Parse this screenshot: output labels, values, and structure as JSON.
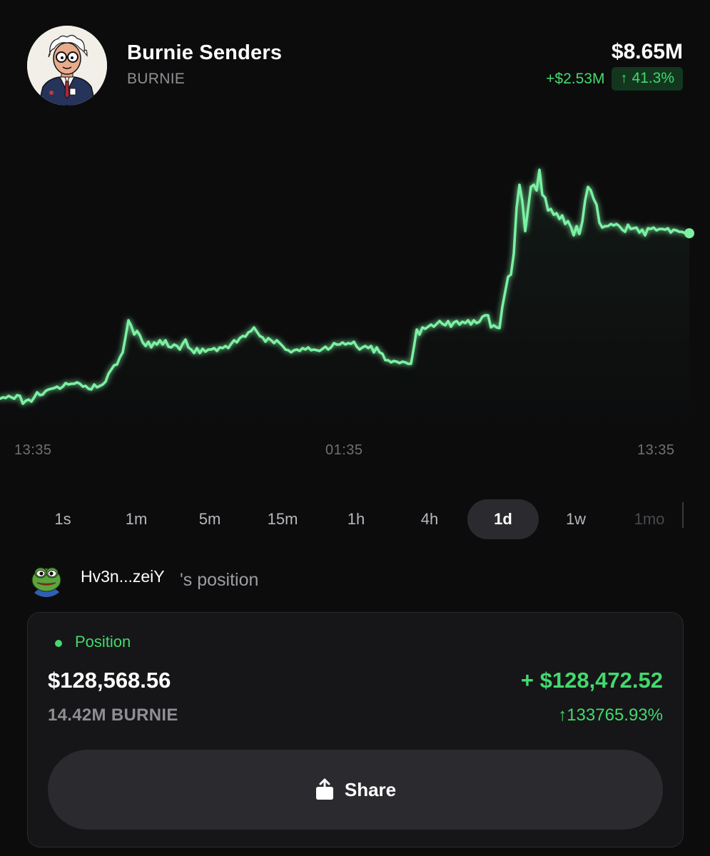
{
  "token": {
    "name": "Burnie Senders",
    "symbol": "BURNIE",
    "price": "$8.65M",
    "change_abs": "+$2.53M",
    "change_pct": "41.3%"
  },
  "chart_data": {
    "type": "line",
    "x_tick_labels": [
      "13:35",
      "01:35",
      "13:35"
    ],
    "line_color": "#7cf1a3",
    "y_unit": "$M market cap",
    "points": [
      [
        0,
        5.91
      ],
      [
        4,
        5.93
      ],
      [
        8,
        5.92
      ],
      [
        12,
        5.95
      ],
      [
        16,
        5.93
      ],
      [
        20,
        5.91
      ],
      [
        24,
        5.96
      ],
      [
        28,
        5.95
      ],
      [
        32,
        5.84
      ],
      [
        36,
        5.88
      ],
      [
        40,
        5.9
      ],
      [
        44,
        5.87
      ],
      [
        48,
        5.93
      ],
      [
        52,
        6.0
      ],
      [
        56,
        5.96
      ],
      [
        60,
        5.97
      ],
      [
        64,
        6.02
      ],
      [
        68,
        6.04
      ],
      [
        72,
        6.05
      ],
      [
        76,
        6.06
      ],
      [
        80,
        6.08
      ],
      [
        84,
        6.05
      ],
      [
        88,
        6.08
      ],
      [
        92,
        6.13
      ],
      [
        96,
        6.11
      ],
      [
        100,
        6.12
      ],
      [
        104,
        6.12
      ],
      [
        108,
        6.14
      ],
      [
        112,
        6.12
      ],
      [
        116,
        6.08
      ],
      [
        120,
        6.09
      ],
      [
        124,
        6.05
      ],
      [
        128,
        6.04
      ],
      [
        132,
        6.11
      ],
      [
        136,
        6.07
      ],
      [
        140,
        6.09
      ],
      [
        144,
        6.11
      ],
      [
        148,
        6.15
      ],
      [
        152,
        6.26
      ],
      [
        156,
        6.32
      ],
      [
        160,
        6.38
      ],
      [
        164,
        6.39
      ],
      [
        168,
        6.49
      ],
      [
        172,
        6.56
      ],
      [
        176,
        6.78
      ],
      [
        180,
        7.01
      ],
      [
        184,
        6.93
      ],
      [
        188,
        6.81
      ],
      [
        192,
        6.86
      ],
      [
        196,
        6.8
      ],
      [
        200,
        6.7
      ],
      [
        204,
        6.65
      ],
      [
        208,
        6.71
      ],
      [
        212,
        6.63
      ],
      [
        216,
        6.7
      ],
      [
        220,
        6.67
      ],
      [
        224,
        6.73
      ],
      [
        228,
        6.67
      ],
      [
        232,
        6.73
      ],
      [
        236,
        6.64
      ],
      [
        240,
        6.63
      ],
      [
        244,
        6.67
      ],
      [
        248,
        6.65
      ],
      [
        252,
        6.6
      ],
      [
        256,
        6.68
      ],
      [
        260,
        6.74
      ],
      [
        264,
        6.63
      ],
      [
        268,
        6.6
      ],
      [
        272,
        6.55
      ],
      [
        276,
        6.62
      ],
      [
        280,
        6.55
      ],
      [
        284,
        6.61
      ],
      [
        288,
        6.57
      ],
      [
        292,
        6.6
      ],
      [
        296,
        6.6
      ],
      [
        300,
        6.62
      ],
      [
        304,
        6.58
      ],
      [
        308,
        6.63
      ],
      [
        312,
        6.62
      ],
      [
        316,
        6.65
      ],
      [
        320,
        6.62
      ],
      [
        324,
        6.68
      ],
      [
        328,
        6.73
      ],
      [
        332,
        6.7
      ],
      [
        336,
        6.76
      ],
      [
        340,
        6.79
      ],
      [
        344,
        6.78
      ],
      [
        348,
        6.84
      ],
      [
        352,
        6.86
      ],
      [
        356,
        6.91
      ],
      [
        360,
        6.85
      ],
      [
        364,
        6.79
      ],
      [
        368,
        6.77
      ],
      [
        372,
        6.71
      ],
      [
        376,
        6.76
      ],
      [
        380,
        6.73
      ],
      [
        384,
        6.69
      ],
      [
        388,
        6.73
      ],
      [
        392,
        6.69
      ],
      [
        396,
        6.65
      ],
      [
        400,
        6.6
      ],
      [
        404,
        6.59
      ],
      [
        408,
        6.56
      ],
      [
        412,
        6.59
      ],
      [
        416,
        6.6
      ],
      [
        420,
        6.58
      ],
      [
        424,
        6.62
      ],
      [
        428,
        6.6
      ],
      [
        432,
        6.63
      ],
      [
        436,
        6.59
      ],
      [
        440,
        6.6
      ],
      [
        444,
        6.59
      ],
      [
        448,
        6.58
      ],
      [
        452,
        6.61
      ],
      [
        456,
        6.64
      ],
      [
        460,
        6.6
      ],
      [
        464,
        6.63
      ],
      [
        468,
        6.69
      ],
      [
        472,
        6.67
      ],
      [
        476,
        6.67
      ],
      [
        480,
        6.7
      ],
      [
        484,
        6.67
      ],
      [
        488,
        6.69
      ],
      [
        492,
        6.68
      ],
      [
        496,
        6.71
      ],
      [
        500,
        6.64
      ],
      [
        504,
        6.6
      ],
      [
        508,
        6.63
      ],
      [
        512,
        6.65
      ],
      [
        516,
        6.62
      ],
      [
        520,
        6.65
      ],
      [
        524,
        6.56
      ],
      [
        528,
        6.63
      ],
      [
        532,
        6.56
      ],
      [
        536,
        6.54
      ],
      [
        540,
        6.45
      ],
      [
        544,
        6.45
      ],
      [
        548,
        6.42
      ],
      [
        552,
        6.44
      ],
      [
        556,
        6.43
      ],
      [
        560,
        6.41
      ],
      [
        564,
        6.43
      ],
      [
        568,
        6.42
      ],
      [
        572,
        6.4
      ],
      [
        576,
        6.4
      ],
      [
        580,
        6.63
      ],
      [
        584,
        6.88
      ],
      [
        588,
        6.81
      ],
      [
        592,
        6.91
      ],
      [
        596,
        6.89
      ],
      [
        600,
        6.92
      ],
      [
        604,
        6.95
      ],
      [
        608,
        6.92
      ],
      [
        612,
        6.96
      ],
      [
        616,
        7.0
      ],
      [
        620,
        6.96
      ],
      [
        624,
        6.94
      ],
      [
        628,
        7.0
      ],
      [
        632,
        6.92
      ],
      [
        636,
        6.98
      ],
      [
        640,
        7.0
      ],
      [
        644,
        6.95
      ],
      [
        648,
        6.99
      ],
      [
        652,
        6.97
      ],
      [
        656,
        7.01
      ],
      [
        660,
        6.95
      ],
      [
        664,
        7.01
      ],
      [
        668,
        6.97
      ],
      [
        672,
        6.99
      ],
      [
        676,
        7.06
      ],
      [
        680,
        7.08
      ],
      [
        684,
        7.08
      ],
      [
        688,
        6.91
      ],
      [
        692,
        6.94
      ],
      [
        696,
        6.91
      ],
      [
        700,
        6.9
      ],
      [
        704,
        7.2
      ],
      [
        708,
        7.41
      ],
      [
        712,
        7.62
      ],
      [
        716,
        7.65
      ],
      [
        720,
        7.94
      ],
      [
        724,
        8.59
      ],
      [
        728,
        8.91
      ],
      [
        732,
        8.68
      ],
      [
        736,
        8.26
      ],
      [
        740,
        8.57
      ],
      [
        744,
        8.88
      ],
      [
        748,
        8.91
      ],
      [
        752,
        8.83
      ],
      [
        756,
        9.12
      ],
      [
        760,
        8.77
      ],
      [
        764,
        8.73
      ],
      [
        768,
        8.55
      ],
      [
        772,
        8.57
      ],
      [
        776,
        8.49
      ],
      [
        780,
        8.51
      ],
      [
        784,
        8.43
      ],
      [
        788,
        8.48
      ],
      [
        792,
        8.36
      ],
      [
        796,
        8.4
      ],
      [
        800,
        8.32
      ],
      [
        804,
        8.2
      ],
      [
        808,
        8.33
      ],
      [
        812,
        8.22
      ],
      [
        816,
        8.39
      ],
      [
        820,
        8.69
      ],
      [
        824,
        8.88
      ],
      [
        828,
        8.83
      ],
      [
        832,
        8.71
      ],
      [
        836,
        8.63
      ],
      [
        840,
        8.38
      ],
      [
        844,
        8.31
      ],
      [
        848,
        8.33
      ],
      [
        852,
        8.33
      ],
      [
        856,
        8.36
      ],
      [
        860,
        8.34
      ],
      [
        864,
        8.36
      ],
      [
        868,
        8.33
      ],
      [
        872,
        8.28
      ],
      [
        876,
        8.25
      ],
      [
        880,
        8.35
      ],
      [
        884,
        8.29
      ],
      [
        888,
        8.3
      ],
      [
        892,
        8.31
      ],
      [
        896,
        8.24
      ],
      [
        900,
        8.28
      ],
      [
        904,
        8.2
      ],
      [
        908,
        8.3
      ],
      [
        912,
        8.29
      ],
      [
        916,
        8.31
      ],
      [
        920,
        8.27
      ],
      [
        924,
        8.29
      ],
      [
        928,
        8.29
      ],
      [
        932,
        8.28
      ],
      [
        936,
        8.3
      ],
      [
        940,
        8.24
      ],
      [
        944,
        8.28
      ],
      [
        948,
        8.27
      ],
      [
        952,
        8.25
      ],
      [
        956,
        8.25
      ],
      [
        960,
        8.23
      ],
      [
        966,
        8.23
      ]
    ]
  },
  "timeframes": [
    {
      "label": "1s"
    },
    {
      "label": "1m"
    },
    {
      "label": "5m"
    },
    {
      "label": "15m"
    },
    {
      "label": "1h"
    },
    {
      "label": "4h"
    },
    {
      "label": "1d"
    },
    {
      "label": "1w"
    },
    {
      "label": "1mo"
    }
  ],
  "selected_timeframe": "1d",
  "owner": {
    "name": "Hv3n...zeiY",
    "suffix": "'s position"
  },
  "position": {
    "label": "Position",
    "value": "$128,568.56",
    "amount": "14.42M BURNIE",
    "pnl": "+ $128,472.52",
    "pnl_pct": "133765.93%"
  },
  "share": {
    "label": "Share"
  },
  "colors": {
    "background": "#0c0c0d",
    "accent_green": "#43d96d",
    "chart_line": "#7cf1a3",
    "card": "#161618",
    "button": "#2b2b2f"
  }
}
